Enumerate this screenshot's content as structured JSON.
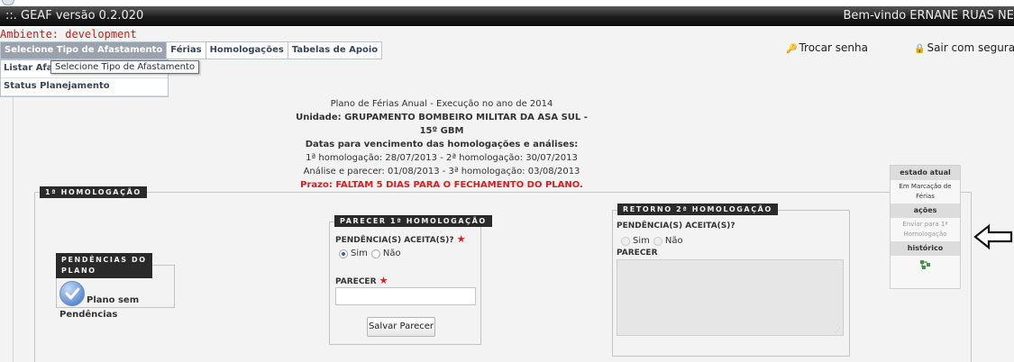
{
  "header": {
    "app_title": "::.  GEAF versão 0.2.020",
    "welcome": "Bem-vindo ERNANE RUAS NE"
  },
  "environment": "Ambiente: development",
  "menu": {
    "items": [
      "Selecione Tipo de Afastamento",
      "Férias",
      "Homologações",
      "Tabelas de Apoio"
    ],
    "active_index": 0,
    "dropdown": [
      "Listar Afas",
      "Status Planejamento"
    ],
    "tooltip": "Selecione Tipo de Afastamento"
  },
  "links": {
    "change_password": "Trocar senha",
    "logout": "Sair com segurança"
  },
  "plan_info": {
    "line1": "Plano de Férias Anual - Execução no ano de 2014",
    "line2": "Unidade: GRUPAMENTO BOMBEIRO MILITAR DA ASA SUL - 15º GBM",
    "line3": "Datas para vencimento das homologações e análises:",
    "line4": "1ª homologação: 28/07/2013 - 2ª homologação: 30/07/2013",
    "line5": "Análise e parecer: 01/08/2013 - 3ª homologação: 03/08/2013",
    "deadline": "Prazo: FALTAM 5 DIAS PARA O FECHAMENTO DO PLANO."
  },
  "homologacao": {
    "title": "1ª HOMOLOGAÇÃO"
  },
  "pendencias": {
    "title_line1": "PENDÊNCIAS DO",
    "title_line2": "PLANO",
    "status_line1": "Plano sem",
    "status_line2": "Pendências"
  },
  "parecer1": {
    "title": "PARECER 1ª HOMOLOGAÇÃO",
    "question": "PENDÊNCIA(S) ACEITA(S)?",
    "yes": "Sim",
    "no": "Não",
    "selected": "Sim",
    "parecer_label": "PARECER",
    "parecer_value": "",
    "save_button": "Salvar Parecer"
  },
  "retorno2": {
    "title": "RETORNO 2ª HOMOLOGAÇÃO",
    "question": "PENDÊNCIA(S) ACEITA(S)?",
    "yes": "Sim",
    "no": "Não",
    "parecer_label": "PARECER"
  },
  "status_panel": {
    "state_header": "estado atual",
    "state_value_line1": "Em Marcação de",
    "state_value_line2": "Férias",
    "actions_header": "ações",
    "action_line1": "Enviar para 1ª",
    "action_line2": "Homologação",
    "history_header": "histórico"
  },
  "icons": {
    "check": "check-circle-icon",
    "history": "history-tree-icon",
    "arrow": "arrow-left-icon",
    "key": "key-icon",
    "lock": "lock-icon"
  },
  "colors": {
    "deadline": "#e01b1b",
    "environment": "#cc1a1a",
    "active_menu": "#9aa3ad",
    "tag_background": "#2a2a2a"
  }
}
